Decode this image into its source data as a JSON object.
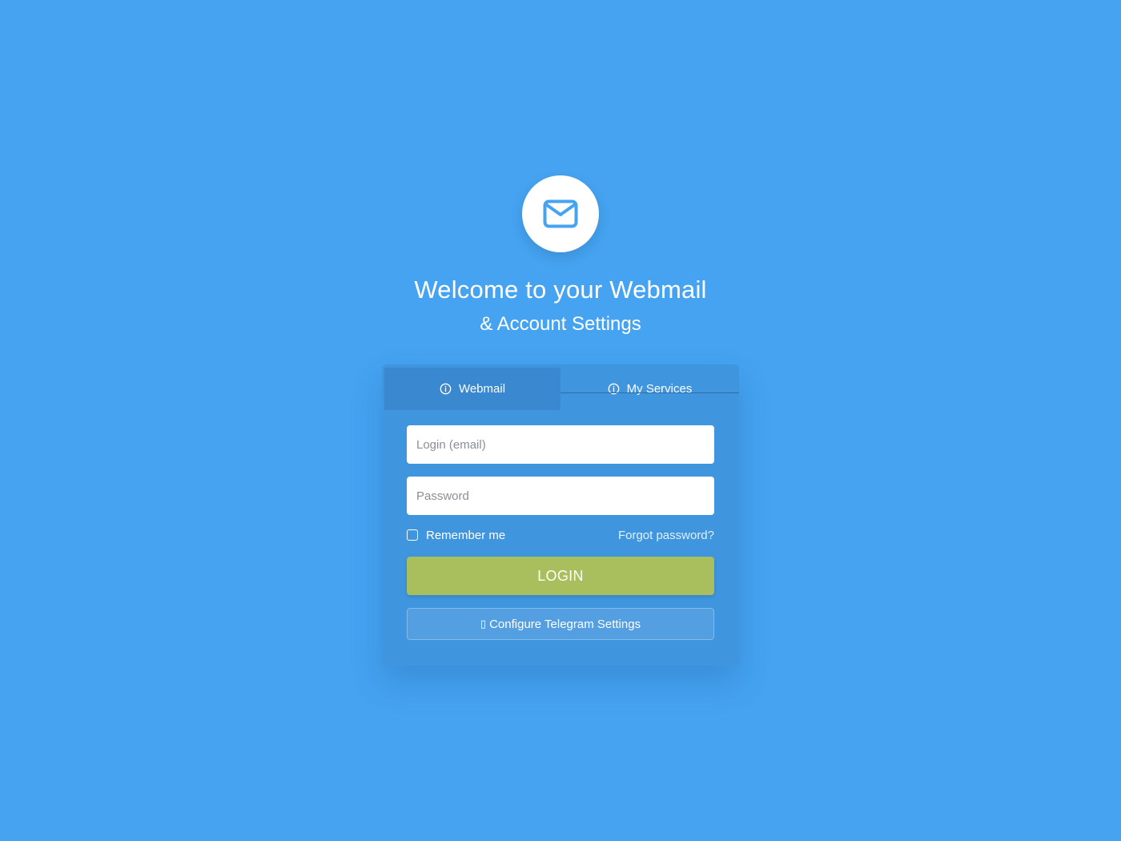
{
  "header": {
    "title": "Welcome to your Webmail",
    "subtitle": "& Account Settings",
    "logo_icon": "envelope-icon"
  },
  "tabs": [
    {
      "label": "Webmail",
      "icon": "info-icon",
      "active": true
    },
    {
      "label": "My Services",
      "icon": "info-icon",
      "active": false
    }
  ],
  "form": {
    "login_placeholder": "Login (email)",
    "login_value": "",
    "password_placeholder": "Password",
    "password_value": "",
    "remember_label": "Remember me",
    "remember_checked": false,
    "forgot_label": "Forgot password?",
    "login_button": "LOGIN",
    "telegram_glyph": "▯",
    "telegram_button": "Configure Telegram Settings"
  },
  "colors": {
    "background": "#45a3f1",
    "card": "#3f95de",
    "active_tab": "#3a88cf",
    "login_button": "#a9be5d",
    "telegram_button": "#539fe2",
    "logo_icon": "#45a3f1"
  }
}
